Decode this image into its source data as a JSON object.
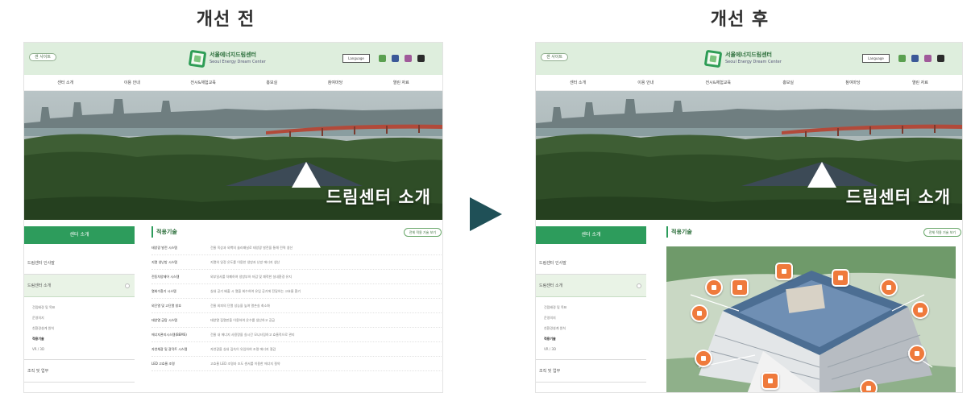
{
  "headings": {
    "before": "개선 전",
    "after": "개선 후"
  },
  "site": {
    "top_link": "센 사이트",
    "logo_ko": "서울에너지드림센터",
    "logo_en": "Seoul Energy Dream Center",
    "language_button": "Language",
    "nav": [
      "센터 소개",
      "이용 안내",
      "전시&체험교육",
      "홍보실",
      "참여마당",
      "열린 자료"
    ],
    "hero_caption": "드림센터 소개",
    "lnb_head": "센터 소개",
    "lnb_items": [
      "드림센터 인사말",
      "드림센터 소개",
      "조직 및 업무"
    ],
    "lnb_sub": [
      "건립배경 및 목표",
      "운영의지",
      "친환경설계 원칙",
      "적용기술",
      "VR / 3D"
    ],
    "section_title": "적용기술",
    "view_all_button": "전체 적용 기술 보기",
    "technologies": [
      {
        "name": "태양광 발전 시스템",
        "desc": "건물 옥상과 외벽의 솔라패널로 태양광 발전을 통해 전력 생산"
      },
      {
        "name": "지열 냉난방 시스템",
        "desc": "지열의 일정 온도를 이용한 냉방과 난방 에너지 생산"
      },
      {
        "name": "전동차양제어 시스템",
        "desc": "외부일사를 차폐하여 냉방부하 저감 및 쾌적한 실내환경 유지"
      },
      {
        "name": "열회수환기 시스템",
        "desc": "실내 공기 배출 시 열을 회수하여 유입 공기에 전달하는 고효율 환기"
      },
      {
        "name": "외단열 및 고단열 창호",
        "desc": "건물 외피의 단열 성능을 높여 열손실 최소화"
      },
      {
        "name": "태양열 급탕 시스템",
        "desc": "태양열 집열판을 이용하여 온수를 생산하고 공급"
      },
      {
        "name": "에너지관리시스템(BEMS)",
        "desc": "건물 내 에너지 사용량을 실시간 모니터링하고 효율적으로 관리"
      },
      {
        "name": "자연채광 및 광덕트 시스템",
        "desc": "자연광을 실내 깊숙이 유입하여 조명 에너지 절감"
      },
      {
        "name": "LED 고효율 조명",
        "desc": "고효율 LED 조명과 조도 센서를 이용한 에너지 절약"
      }
    ]
  },
  "colors": {
    "header_bg": "#deeedd",
    "accent_green": "#2d9c5c",
    "arrow": "#1f5057",
    "badge_orange": "#ef7a3c"
  },
  "icons": [
    "right-triangle-arrow-icon",
    "logo-icon",
    "blog-icon",
    "facebook-icon",
    "instagram-icon",
    "youtube-icon"
  ]
}
